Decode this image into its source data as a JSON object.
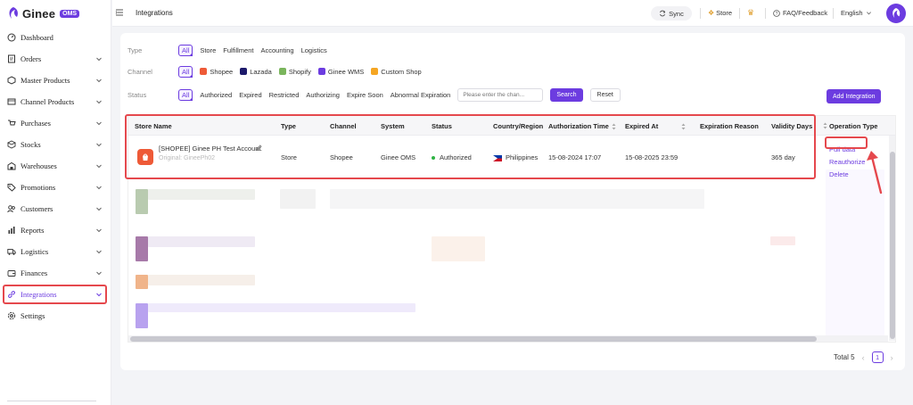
{
  "app": {
    "name": "Ginee",
    "badge": "OMS"
  },
  "sidebar": {
    "items": [
      {
        "label": "Dashboard",
        "icon": "dashboard-icon",
        "has_chevron": false
      },
      {
        "label": "Orders",
        "icon": "orders-icon",
        "has_chevron": true
      },
      {
        "label": "Master Products",
        "icon": "master-products-icon",
        "has_chevron": true
      },
      {
        "label": "Channel Products",
        "icon": "channel-products-icon",
        "has_chevron": true
      },
      {
        "label": "Purchases",
        "icon": "purchases-icon",
        "has_chevron": true
      },
      {
        "label": "Stocks",
        "icon": "stocks-icon",
        "has_chevron": true
      },
      {
        "label": "Warehouses",
        "icon": "warehouses-icon",
        "has_chevron": true
      },
      {
        "label": "Promotions",
        "icon": "promotions-icon",
        "has_chevron": true
      },
      {
        "label": "Customers",
        "icon": "customers-icon",
        "has_chevron": true
      },
      {
        "label": "Reports",
        "icon": "reports-icon",
        "has_chevron": true
      },
      {
        "label": "Logistics",
        "icon": "logistics-icon",
        "has_chevron": true
      },
      {
        "label": "Finances",
        "icon": "finances-icon",
        "has_chevron": true
      },
      {
        "label": "Integrations",
        "icon": "integrations-icon",
        "has_chevron": true,
        "active": true
      },
      {
        "label": "Settings",
        "icon": "settings-icon",
        "has_chevron": false
      }
    ]
  },
  "topbar": {
    "title": "Integrations",
    "sync_label": "Sync",
    "store_label": "Store",
    "faq_label": "FAQ/Feedback",
    "language": "English"
  },
  "filters": {
    "type": {
      "label": "Type",
      "options": [
        "All",
        "Store",
        "Fulfillment",
        "Accounting",
        "Logistics"
      ],
      "selected": "All"
    },
    "channel": {
      "label": "Channel",
      "options": [
        {
          "name": "All"
        },
        {
          "name": "Shopee",
          "color": "#ee5a37"
        },
        {
          "name": "Lazada",
          "color": "#1d1a6b"
        },
        {
          "name": "Shopify",
          "color": "#7ab55c"
        },
        {
          "name": "Ginee WMS",
          "color": "#6c3ce0"
        },
        {
          "name": "Custom Shop",
          "color": "#f5a623"
        }
      ],
      "selected": "All"
    },
    "status": {
      "label": "Status",
      "options": [
        "All",
        "Authorized",
        "Expired",
        "Restricted",
        "Authorizing",
        "Expire Soon",
        "Abnormal Expiration"
      ],
      "selected": "All"
    },
    "search_placeholder": "Please enter the chan...",
    "search_button": "Search",
    "reset_button": "Reset",
    "add_button": "Add Integration"
  },
  "table": {
    "columns": [
      "Store Name",
      "Type",
      "Channel",
      "System",
      "Status",
      "Country/Region",
      "Authorization Time",
      "Expired At",
      "Expiration Reason",
      "Validity Days",
      "Operation Type"
    ],
    "rows": [
      {
        "store_name": "[SHOPEE] Ginee PH Test Account",
        "original": "Original: GineePh02",
        "type": "Store",
        "channel": "Shopee",
        "system": "Ginee OMS",
        "status": "Authorized",
        "country": "Philippines",
        "authorization_time": "15-08-2024 17:07",
        "expired_at": "15-08-2025 23:59",
        "expiration_reason": "",
        "validity_days": "365 day",
        "operations": [
          "Pull data",
          "Reauthorize",
          "Delete"
        ]
      }
    ]
  },
  "pagination": {
    "total_label": "Total 5",
    "current_page": "1"
  },
  "colors": {
    "accent": "#6c3ce0",
    "highlight": "#e5484d",
    "status_ok": "#2fb344"
  }
}
